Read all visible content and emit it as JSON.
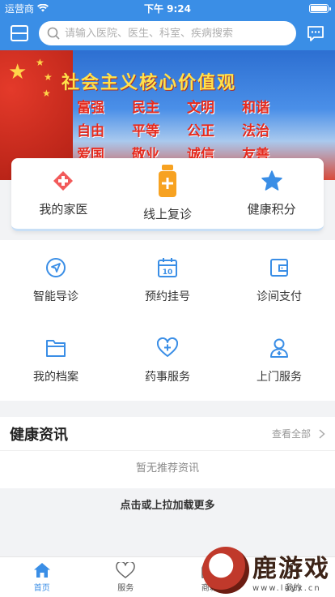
{
  "status_bar": {
    "carrier": "运营商",
    "time": "下午 9:24"
  },
  "topbar": {
    "menu_icon": "menu-icon",
    "search_placeholder": "请输入医院、医生、科室、疾病搜索",
    "message_icon": "message-icon"
  },
  "banner": {
    "title": "社会主义核心价值观",
    "values": [
      "富强",
      "民主",
      "文明",
      "和谐",
      "自由",
      "平等",
      "公正",
      "法治",
      "爱国",
      "敬业",
      "诚信",
      "友善"
    ]
  },
  "quick_actions": [
    {
      "label": "我的家医",
      "icon": "medical-cross-icon",
      "color": "#f25a5a"
    },
    {
      "label": "线上复诊",
      "icon": "medicine-bottle-icon",
      "color": "#f7a221"
    },
    {
      "label": "健康积分",
      "icon": "star-icon",
      "color": "#3a8ee6"
    }
  ],
  "services": [
    {
      "label": "智能导诊",
      "icon": "navigation-icon"
    },
    {
      "label": "预约挂号",
      "icon": "calendar-icon"
    },
    {
      "label": "诊间支付",
      "icon": "wallet-icon"
    },
    {
      "label": "我的档案",
      "icon": "folder-icon"
    },
    {
      "label": "药事服务",
      "icon": "heart-plus-icon"
    },
    {
      "label": "上门服务",
      "icon": "nurse-icon"
    }
  ],
  "news": {
    "title": "健康资讯",
    "view_all": "查看全部",
    "empty_text": "暂无推荐资讯"
  },
  "load_more": "点击或上拉加载更多",
  "tabs": [
    {
      "label": "首页",
      "icon": "home-icon",
      "active": true
    },
    {
      "label": "服务",
      "icon": "heart-icon",
      "active": false
    },
    {
      "label": "商城",
      "icon": "shop-icon",
      "active": false
    },
    {
      "label": "我的",
      "icon": "user-icon",
      "active": false
    }
  ],
  "watermark": {
    "text": "鹿游戏",
    "url": "www.luyx.cn"
  },
  "colors": {
    "primary": "#3a8ee6",
    "banner_red": "#e52b1f",
    "banner_yellow": "#ffe14a"
  }
}
